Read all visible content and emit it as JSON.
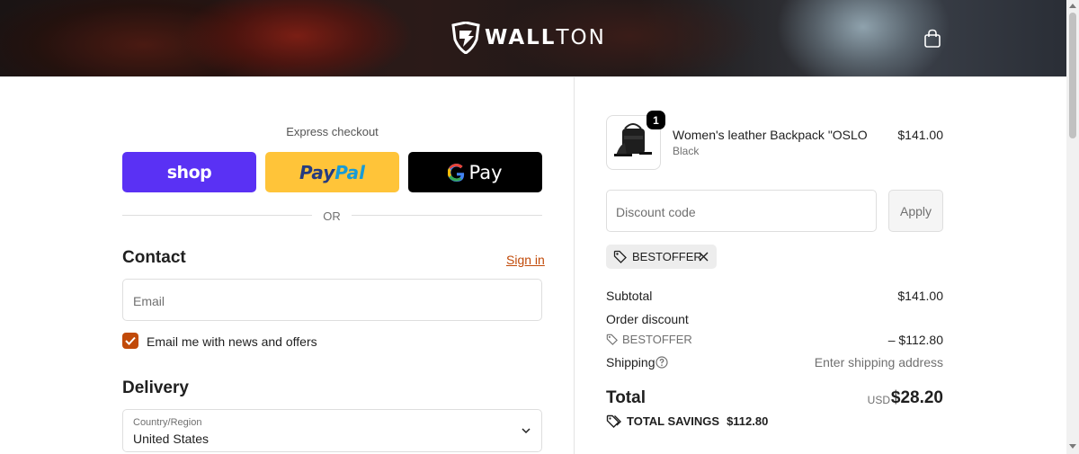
{
  "header": {
    "brand_bold": "WALL",
    "brand_light": "TON",
    "cart_icon": "shopping-bag-icon"
  },
  "express": {
    "title": "Express checkout",
    "shop_label": "shop",
    "paypal_label_1": "Pay",
    "paypal_label_2": "Pal",
    "gpay_label": "Pay",
    "or_label": "OR"
  },
  "contact": {
    "title": "Contact",
    "signin_label": "Sign in",
    "email_placeholder": "Email",
    "newsletter_label": "Email me with news and offers",
    "newsletter_checked": true
  },
  "delivery": {
    "title": "Delivery",
    "country_label": "Country/Region",
    "country_value": "United States"
  },
  "order": {
    "item": {
      "name": "Women's leather Backpack \"OSLO",
      "variant": "Black",
      "price": "$141.00",
      "quantity": "1"
    },
    "discount_placeholder": "Discount code",
    "apply_label": "Apply",
    "applied_code": "BESTOFFER",
    "subtotal_label": "Subtotal",
    "subtotal_value": "$141.00",
    "order_discount_label": "Order discount",
    "discount_code": "BESTOFFER",
    "discount_value": "– $112.80",
    "shipping_label": "Shipping",
    "shipping_value": "Enter shipping address",
    "total_label": "Total",
    "currency": "USD",
    "total_value": "$28.20",
    "savings_label": "TOTAL SAVINGS",
    "savings_value": "$112.80"
  },
  "colors": {
    "accent": "#c14a09",
    "shop_pay": "#5a31f4",
    "paypal": "#ffc439"
  }
}
